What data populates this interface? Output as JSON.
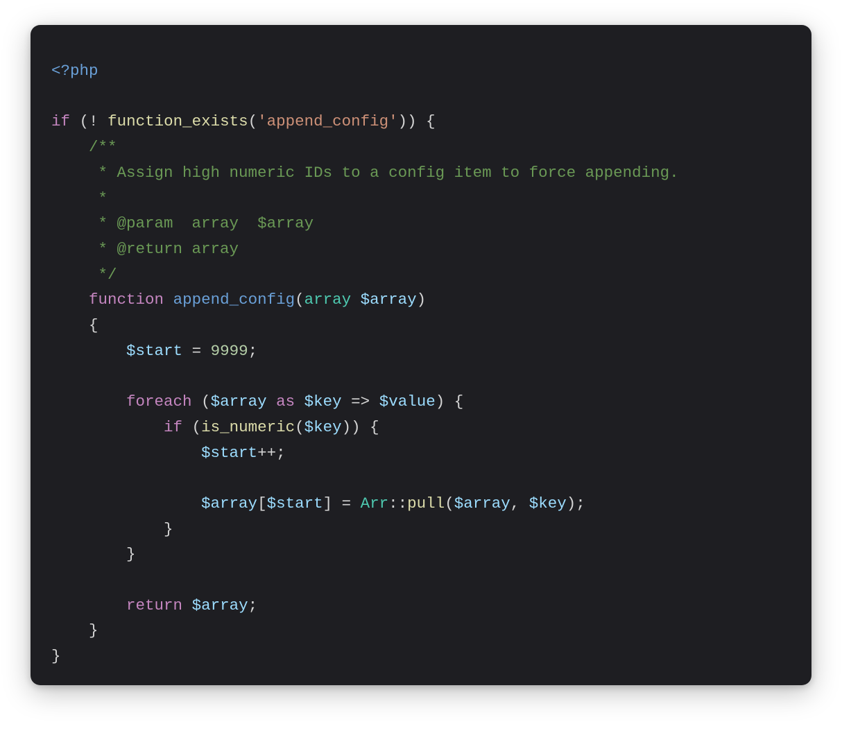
{
  "tokens": {
    "php_open": "<?php",
    "kw_if": "if",
    "fn_function_exists": "function_exists",
    "str_append_config": "'append_config'",
    "cmt_open": "/**",
    "cmt_l1": " * Assign high numeric IDs to a config item to force appending.",
    "cmt_l2": " *",
    "cmt_l3a": " * @param  array  ",
    "cmt_l3_var": "$array",
    "cmt_l4": " * @return array",
    "cmt_close": " */",
    "kw_function": "function",
    "def_name": "append_config",
    "type_array": "array",
    "var_array": "$array",
    "var_start": "$start",
    "num_9999": "9999",
    "kw_foreach": "foreach",
    "kw_as": "as",
    "var_key": "$key",
    "var_value": "$value",
    "fn_is_numeric": "is_numeric",
    "type_Arr": "Arr",
    "fn_pull": "pull",
    "kw_return": "return"
  },
  "syntax": {
    "lparen": "(",
    "rparen": ")",
    "lbrace": "{",
    "rbrace": "}",
    "lbracket": "[",
    "rbracket": "]",
    "bang": "!",
    "space": " ",
    "semicolon": ";",
    "equals": "=",
    "plusplus": "++",
    "comma": ",",
    "dcolon": "::",
    "arrow": "=>"
  }
}
